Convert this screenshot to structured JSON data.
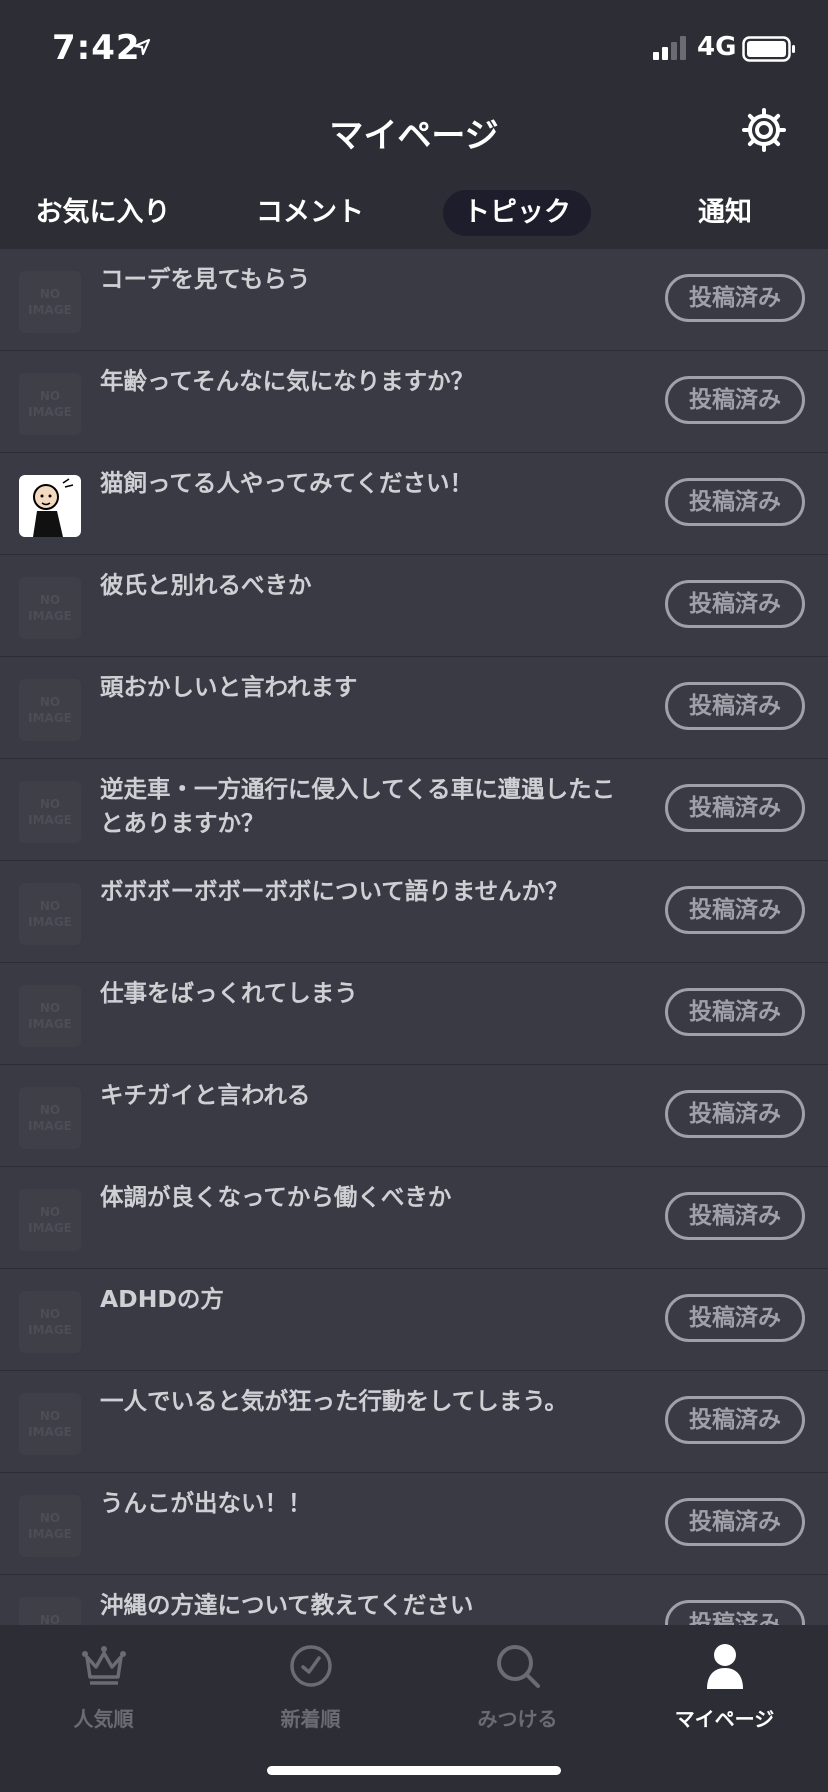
{
  "status_bar": {
    "time": "7:42",
    "network": "4G"
  },
  "header": {
    "title": "マイページ"
  },
  "tabs": [
    {
      "label": "お気に入り",
      "active": false
    },
    {
      "label": "コメント",
      "active": false
    },
    {
      "label": "トピック",
      "active": true
    },
    {
      "label": "通知",
      "active": false
    }
  ],
  "no_image_text": [
    "NO",
    "IMAGE"
  ],
  "topics": [
    {
      "title": "コーデを見てもらう",
      "status": "投稿済み",
      "thumb": "no-image"
    },
    {
      "title": "年齢ってそんなに気になりますか？",
      "status": "投稿済み",
      "thumb": "no-image"
    },
    {
      "title": "猫飼ってる人やってみてください！",
      "status": "投稿済み",
      "thumb": "image"
    },
    {
      "title": "彼氏と別れるべきか",
      "status": "投稿済み",
      "thumb": "no-image"
    },
    {
      "title": "頭おかしいと言われます",
      "status": "投稿済み",
      "thumb": "no-image"
    },
    {
      "title": "逆走車・一方通行に侵入してくる車に遭遇したことありますか？",
      "status": "投稿済み",
      "thumb": "no-image"
    },
    {
      "title": "ボボボーボボーボボについて語りませんか？",
      "status": "投稿済み",
      "thumb": "no-image"
    },
    {
      "title": "仕事をばっくれてしまう",
      "status": "投稿済み",
      "thumb": "no-image"
    },
    {
      "title": "キチガイと言われる",
      "status": "投稿済み",
      "thumb": "no-image"
    },
    {
      "title": "体調が良くなってから働くべきか",
      "status": "投稿済み",
      "thumb": "no-image"
    },
    {
      "title": "ADHDの方",
      "status": "投稿済み",
      "thumb": "no-image"
    },
    {
      "title": "一人でいると気が狂った行動をしてしまう。",
      "status": "投稿済み",
      "thumb": "no-image"
    },
    {
      "title": "うんこが出ない！！",
      "status": "投稿済み",
      "thumb": "no-image"
    },
    {
      "title": "沖縄の方達について教えてください",
      "status": "投稿済み",
      "thumb": "no-image"
    }
  ],
  "bottom_nav": [
    {
      "label": "人気順",
      "icon": "crown-icon",
      "active": false
    },
    {
      "label": "新着順",
      "icon": "clock-check-icon",
      "active": false
    },
    {
      "label": "みつける",
      "icon": "search-icon",
      "active": false
    },
    {
      "label": "マイページ",
      "icon": "person-icon",
      "active": true
    }
  ],
  "colors": {
    "background": "#3a3a44",
    "header": "#2d2d35",
    "active_tab": "#1d1d2c",
    "badge": "#a0a0a8"
  }
}
